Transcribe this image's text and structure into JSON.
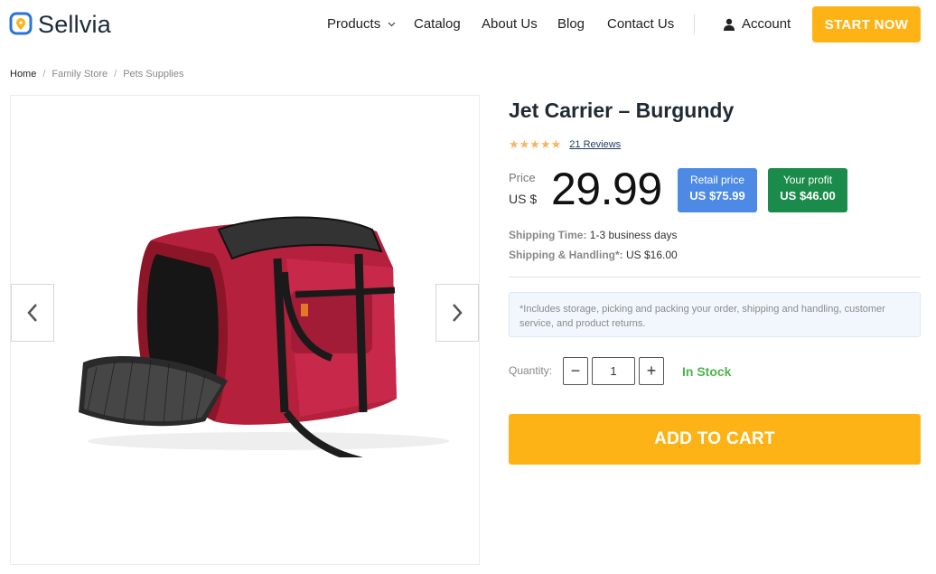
{
  "brand": {
    "name": "Sellvia",
    "accent": "#fdb316",
    "logo_color": "#2a74d6"
  },
  "nav": {
    "items": [
      {
        "label": "Products",
        "has_dropdown": true
      },
      {
        "label": "Catalog"
      },
      {
        "label": "About Us"
      },
      {
        "label": "Blog"
      },
      {
        "label": "Contact Us"
      }
    ],
    "account_label": "Account",
    "cta_label": "START NOW"
  },
  "breadcrumb": [
    "Home",
    "Family Store",
    "Pets Supplies"
  ],
  "gallery": {
    "prev_icon": "chevron-left-icon",
    "next_icon": "chevron-right-icon",
    "image_alt": "burgundy pet carrier bag"
  },
  "product": {
    "title": "Jet Carrier – Burgundy",
    "rating": 5,
    "stars": "★★★★★",
    "reviews_label": "21 Reviews",
    "price_label": "Price",
    "currency": "US $",
    "price": "29.99",
    "retail": {
      "label": "Retail price",
      "value": "US $75.99",
      "color": "#4d8ae6"
    },
    "profit": {
      "label": "Your profit",
      "value": "US $46.00",
      "color": "#1a8b4a"
    },
    "shipping_time": {
      "label": "Shipping Time:",
      "value": "1-3 business days"
    },
    "shipping_handling": {
      "label": "Shipping & Handling*:",
      "value": "US $16.00"
    },
    "note": "*Includes storage, picking and packing your order, shipping and handling, customer service, and product returns.",
    "quantity_label": "Quantity:",
    "quantity": "1",
    "minus_label": "−",
    "plus_label": "+",
    "stock_status": "In Stock",
    "stock_color": "#4db34d",
    "add_to_cart_label": "ADD TO CART"
  }
}
